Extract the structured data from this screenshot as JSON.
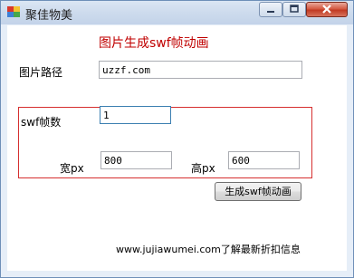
{
  "window": {
    "title": "聚佳物美",
    "icon": "app-icon",
    "controls": [
      "minimize-icon",
      "maximize-icon",
      "close-icon"
    ]
  },
  "form": {
    "heading": "图片生成swf帧动画",
    "path_label": "图片路径",
    "path_value": "uzzf.com",
    "frames_label": "swf帧数",
    "frames_value": "1",
    "width_label": "宽px",
    "width_value": "800",
    "height_label": "高px",
    "height_value": "600",
    "generate_button": "生成swf帧动画",
    "footer": "www.jujiawumei.com了解最新折扣信息"
  },
  "colors": {
    "heading": "#c00000",
    "group_border": "#d62f2f",
    "window_frame": "#6e8fb8",
    "focus_border": "#3c7fb1"
  }
}
